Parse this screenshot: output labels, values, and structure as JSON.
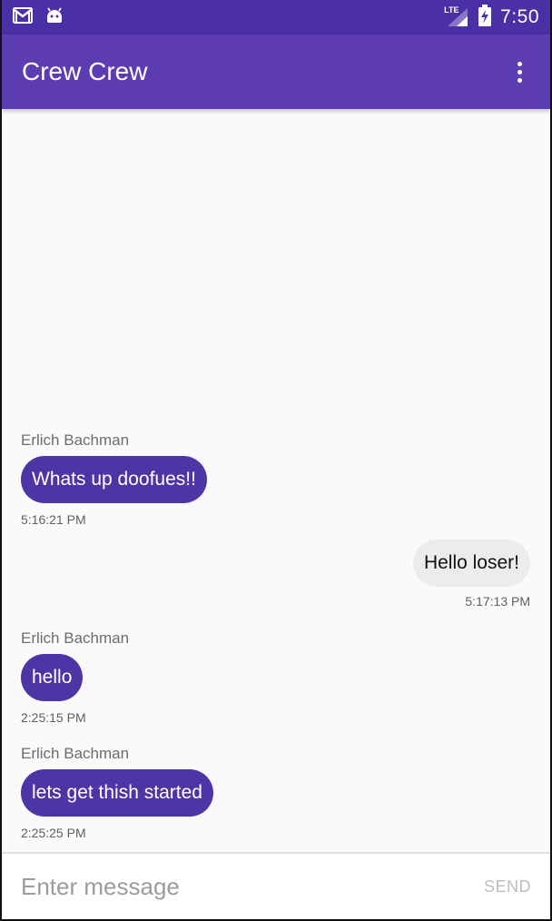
{
  "status_bar": {
    "time": "7:50",
    "network_label": "LTE",
    "icons": [
      "gmail-icon",
      "android-icon",
      "lte-signal-icon",
      "battery-charging-icon"
    ]
  },
  "app_bar": {
    "title": "Crew Crew",
    "menu_icon": "more-vert-icon"
  },
  "messages": [
    {
      "direction": "in",
      "sender": "Erlich Bachman",
      "text": "Whats up doofues!!",
      "time": "5:16:21 PM"
    },
    {
      "direction": "out",
      "sender": "",
      "text": "Hello loser!",
      "time": "5:17:13 PM"
    },
    {
      "direction": "in",
      "sender": "Erlich Bachman",
      "text": "hello",
      "time": "2:25:15 PM"
    },
    {
      "direction": "in",
      "sender": "Erlich Bachman",
      "text": "lets get thish started",
      "time": "2:25:25 PM"
    }
  ],
  "composer": {
    "placeholder": "Enter message",
    "value": "",
    "send_label": "SEND"
  },
  "colors": {
    "status_bar": "#4a2fa6",
    "app_bar": "#5e3db3",
    "incoming_bubble": "#4e35a6",
    "outgoing_bubble": "#ececec",
    "send_disabled": "#bdbdbd"
  }
}
